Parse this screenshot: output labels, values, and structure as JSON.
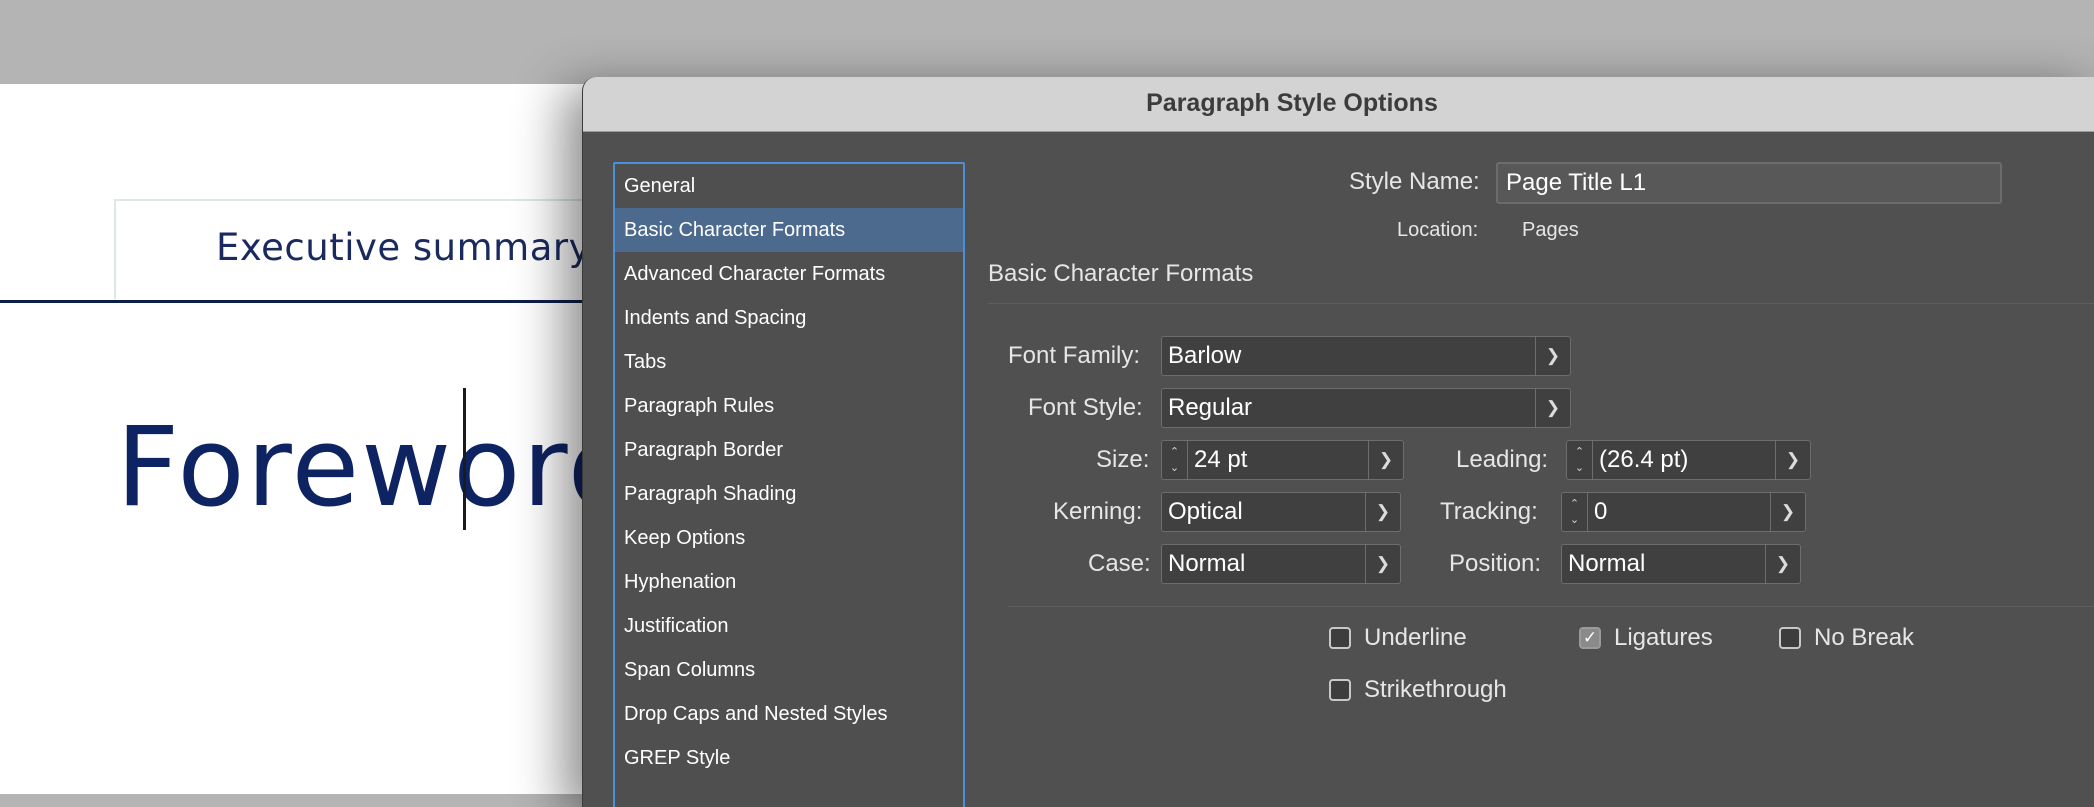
{
  "document": {
    "tab_label": "Executive summary",
    "heading": "Foreword"
  },
  "dialog": {
    "title": "Paragraph Style Options",
    "categories": [
      "General",
      "Basic Character Formats",
      "Advanced Character Formats",
      "Indents and Spacing",
      "Tabs",
      "Paragraph Rules",
      "Paragraph Border",
      "Paragraph Shading",
      "Keep Options",
      "Hyphenation",
      "Justification",
      "Span Columns",
      "Drop Caps and Nested Styles",
      "GREP Style"
    ],
    "selected_category": "Basic Character Formats",
    "style_name_label": "Style Name:",
    "style_name_value": "Page Title L1",
    "location_label": "Location:",
    "location_value": "Pages",
    "section_title": "Basic Character Formats",
    "fields": {
      "font_family": {
        "label": "Font Family:",
        "value": "Barlow"
      },
      "font_style": {
        "label": "Font Style:",
        "value": "Regular"
      },
      "size": {
        "label": "Size:",
        "value": "24 pt"
      },
      "leading": {
        "label": "Leading:",
        "value": "(26.4 pt)"
      },
      "kerning": {
        "label": "Kerning:",
        "value": "Optical"
      },
      "tracking": {
        "label": "Tracking:",
        "value": "0"
      },
      "case": {
        "label": "Case:",
        "value": "Normal"
      },
      "position": {
        "label": "Position:",
        "value": "Normal"
      }
    },
    "checkboxes": {
      "underline": {
        "label": "Underline",
        "checked": false
      },
      "ligatures": {
        "label": "Ligatures",
        "checked": true
      },
      "no_break": {
        "label": "No Break",
        "checked": false
      },
      "strikethrough": {
        "label": "Strikethrough",
        "checked": false
      }
    }
  },
  "colors": {
    "selection": "#4b6a8e",
    "list_focus_border": "#4b8fd8",
    "doc_navy": "#0e2361"
  }
}
